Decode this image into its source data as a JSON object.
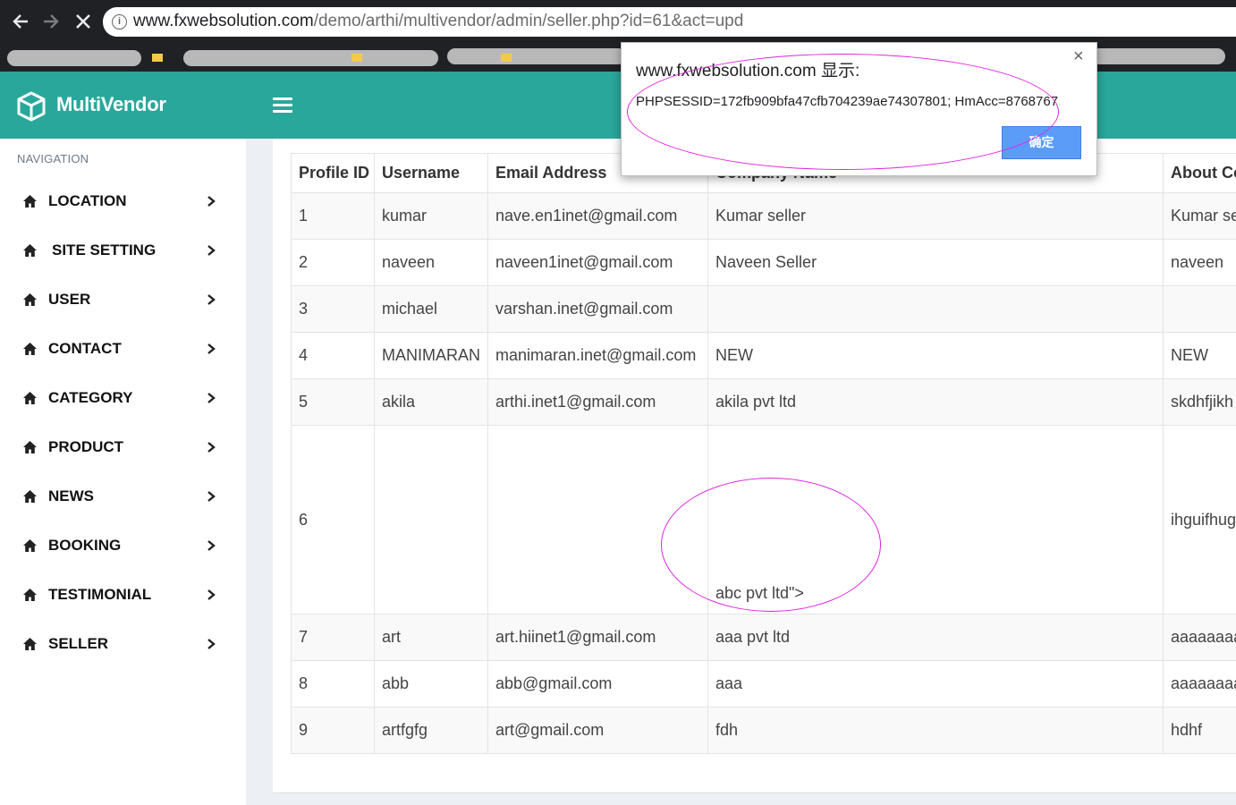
{
  "browser": {
    "url_host": "www.fxwebsolution.com",
    "url_path": "/demo/arthi/multivendor/admin/seller.php?id=61&act=upd",
    "back_icon": "arrow-left-icon",
    "forward_icon": "arrow-right-icon",
    "stop_icon": "close-icon"
  },
  "app": {
    "brand": "MultiVendor",
    "accent_color": "#2aa79b"
  },
  "sidebar": {
    "nav_heading": "NAVIGATION",
    "items": [
      {
        "label": "LOCATION"
      },
      {
        "label": "SITE SETTING"
      },
      {
        "label": "USER"
      },
      {
        "label": "CONTACT"
      },
      {
        "label": "CATEGORY"
      },
      {
        "label": "PRODUCT"
      },
      {
        "label": "NEWS"
      },
      {
        "label": "BOOKING"
      },
      {
        "label": "TESTIMONIAL"
      },
      {
        "label": "SELLER"
      }
    ]
  },
  "table": {
    "headers": [
      "Profile ID",
      "Username",
      "Email Address",
      "Company Name",
      "About Co"
    ],
    "rows": [
      [
        "1",
        "kumar",
        "nave.en1inet@gmail.com",
        "Kumar seller",
        "Kumar se"
      ],
      [
        "2",
        "naveen",
        "naveen1inet@gmail.com",
        "Naveen Seller",
        "naveen"
      ],
      [
        "3",
        "michael",
        "varshan.inet@gmail.com",
        "",
        ""
      ],
      [
        "4",
        "MANIMARAN",
        "manimaran.inet@gmail.com",
        "NEW",
        "NEW"
      ],
      [
        "5",
        "akila",
        "arthi.inet1@gmail.com",
        "akila pvt ltd",
        "skdhfjikh"
      ],
      [
        "6",
        "",
        "",
        "abc pvt ltd\">",
        "ihguifhug"
      ],
      [
        "7",
        "art",
        "art.hiinet1@gmail.com",
        "aaa pvt ltd",
        "aaaaaaaa"
      ],
      [
        "8",
        "abb",
        "abb@gmail.com",
        "aaa",
        "aaaaaaaa"
      ],
      [
        "9",
        "artfgfg",
        "art@gmail.com",
        "fdh",
        "hdhf"
      ]
    ]
  },
  "dialog": {
    "title": "www.fxwebsolution.com 显示:",
    "message": "PHPSESSID=172fb909bfa47cfb704239ae74307801; HmAcc=8768767",
    "ok_label": "确定",
    "close_glyph": "×"
  }
}
